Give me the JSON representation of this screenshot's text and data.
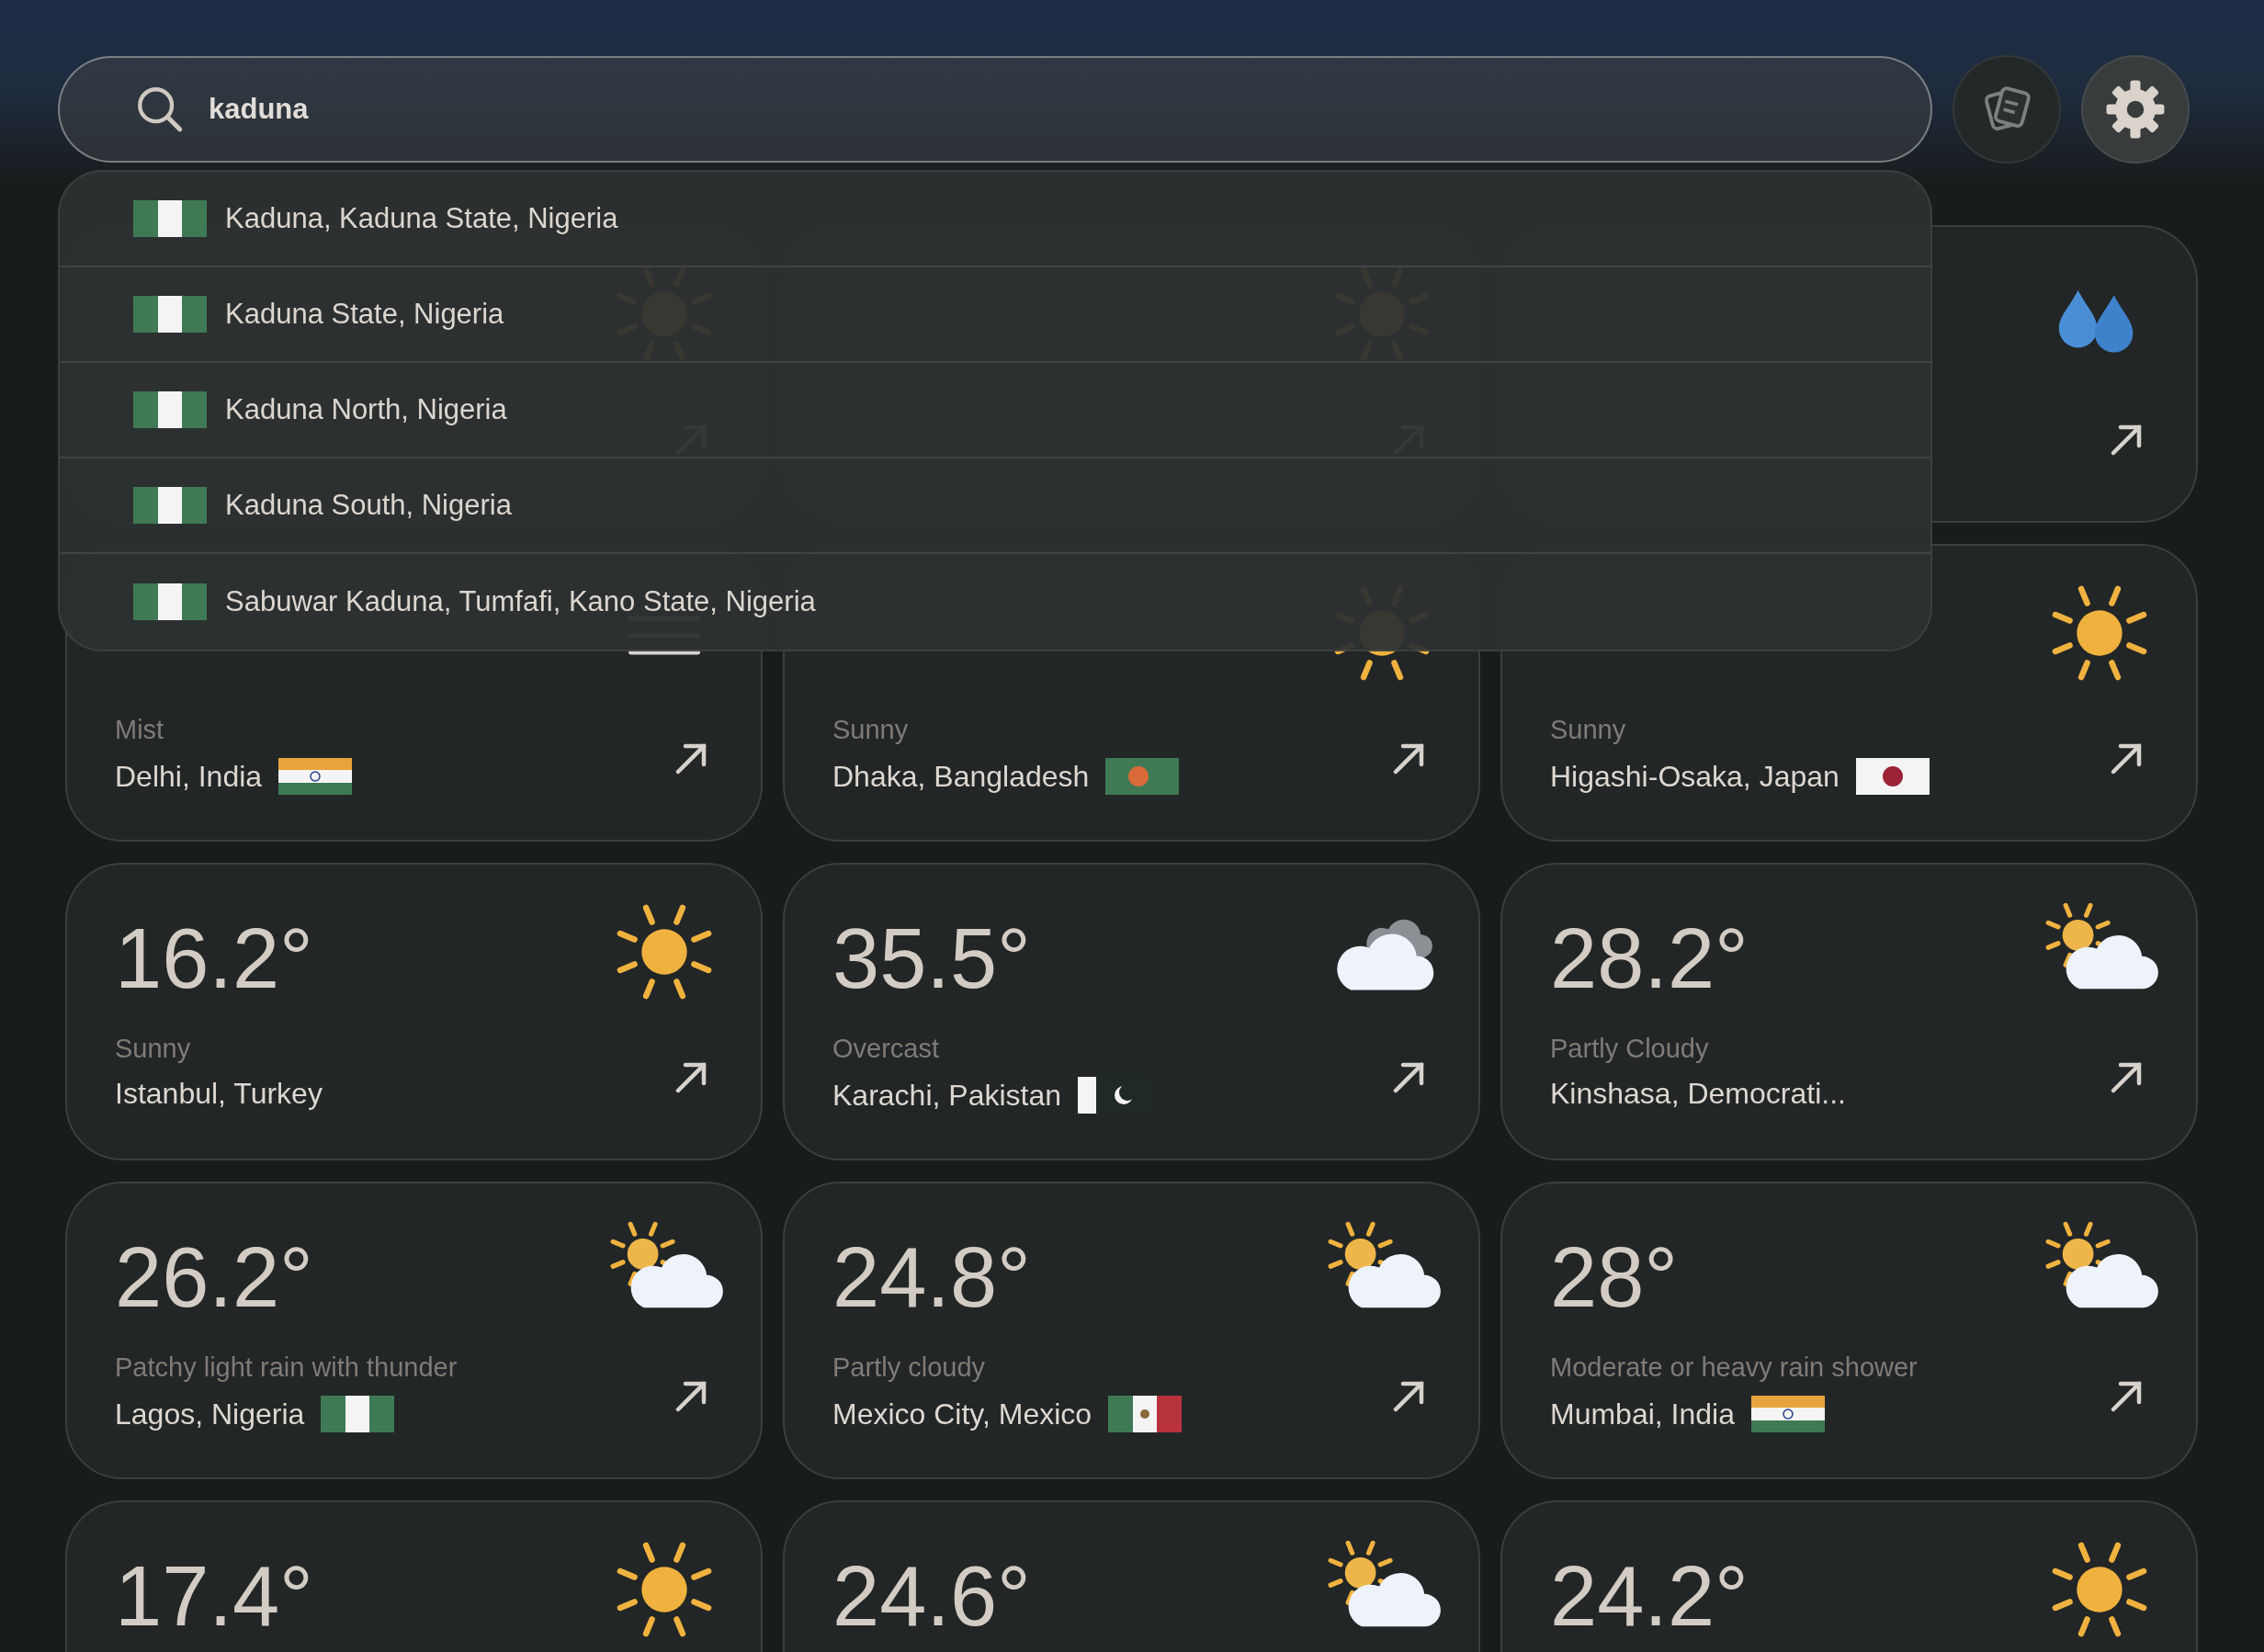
{
  "search": {
    "value": "kaduna"
  },
  "suggestions": [
    {
      "label": "Kaduna, Kaduna State, Nigeria"
    },
    {
      "label": "Kaduna State, Nigeria"
    },
    {
      "label": "Kaduna North, Nigeria"
    },
    {
      "label": "Kaduna South, Nigeria"
    },
    {
      "label": "Sabuwar Kaduna, Tumfafi, Kano State, Nigeria"
    }
  ],
  "cards": [
    {
      "kind": "sunny"
    },
    {
      "kind": "sunny"
    },
    {
      "kind": "rain"
    },
    {
      "kind": "mist",
      "condition": "Mist",
      "location": "Delhi, India"
    },
    {
      "kind": "sunny",
      "condition": "Sunny",
      "location": "Dhaka, Bangladesh"
    },
    {
      "kind": "sunny",
      "condition": "Sunny",
      "location": "Higashi-Osaka, Japan"
    },
    {
      "temp": "16.2°",
      "kind": "sunny",
      "condition": "Sunny",
      "location": "Istanbul, Turkey"
    },
    {
      "temp": "35.5°",
      "kind": "overcast",
      "condition": "Overcast",
      "location": "Karachi, Pakistan"
    },
    {
      "temp": "28.2°",
      "kind": "cloudy",
      "condition": "Partly Cloudy",
      "location": "Kinshasa, Democrati..."
    },
    {
      "temp": "26.2°",
      "kind": "cloudy",
      "condition": "Patchy light rain with thunder",
      "location": "Lagos, Nigeria"
    },
    {
      "temp": "24.8°",
      "kind": "cloudy",
      "condition": "Partly cloudy",
      "location": "Mexico City, Mexico"
    },
    {
      "temp": "28°",
      "kind": "cloudy",
      "condition": "Moderate or heavy rain shower",
      "location": "Mumbai, India"
    },
    {
      "temp": "17.4°",
      "kind": "sunny"
    },
    {
      "temp": "24.6°",
      "kind": "cloudy"
    },
    {
      "temp": "24.2°",
      "kind": "sunny"
    }
  ]
}
